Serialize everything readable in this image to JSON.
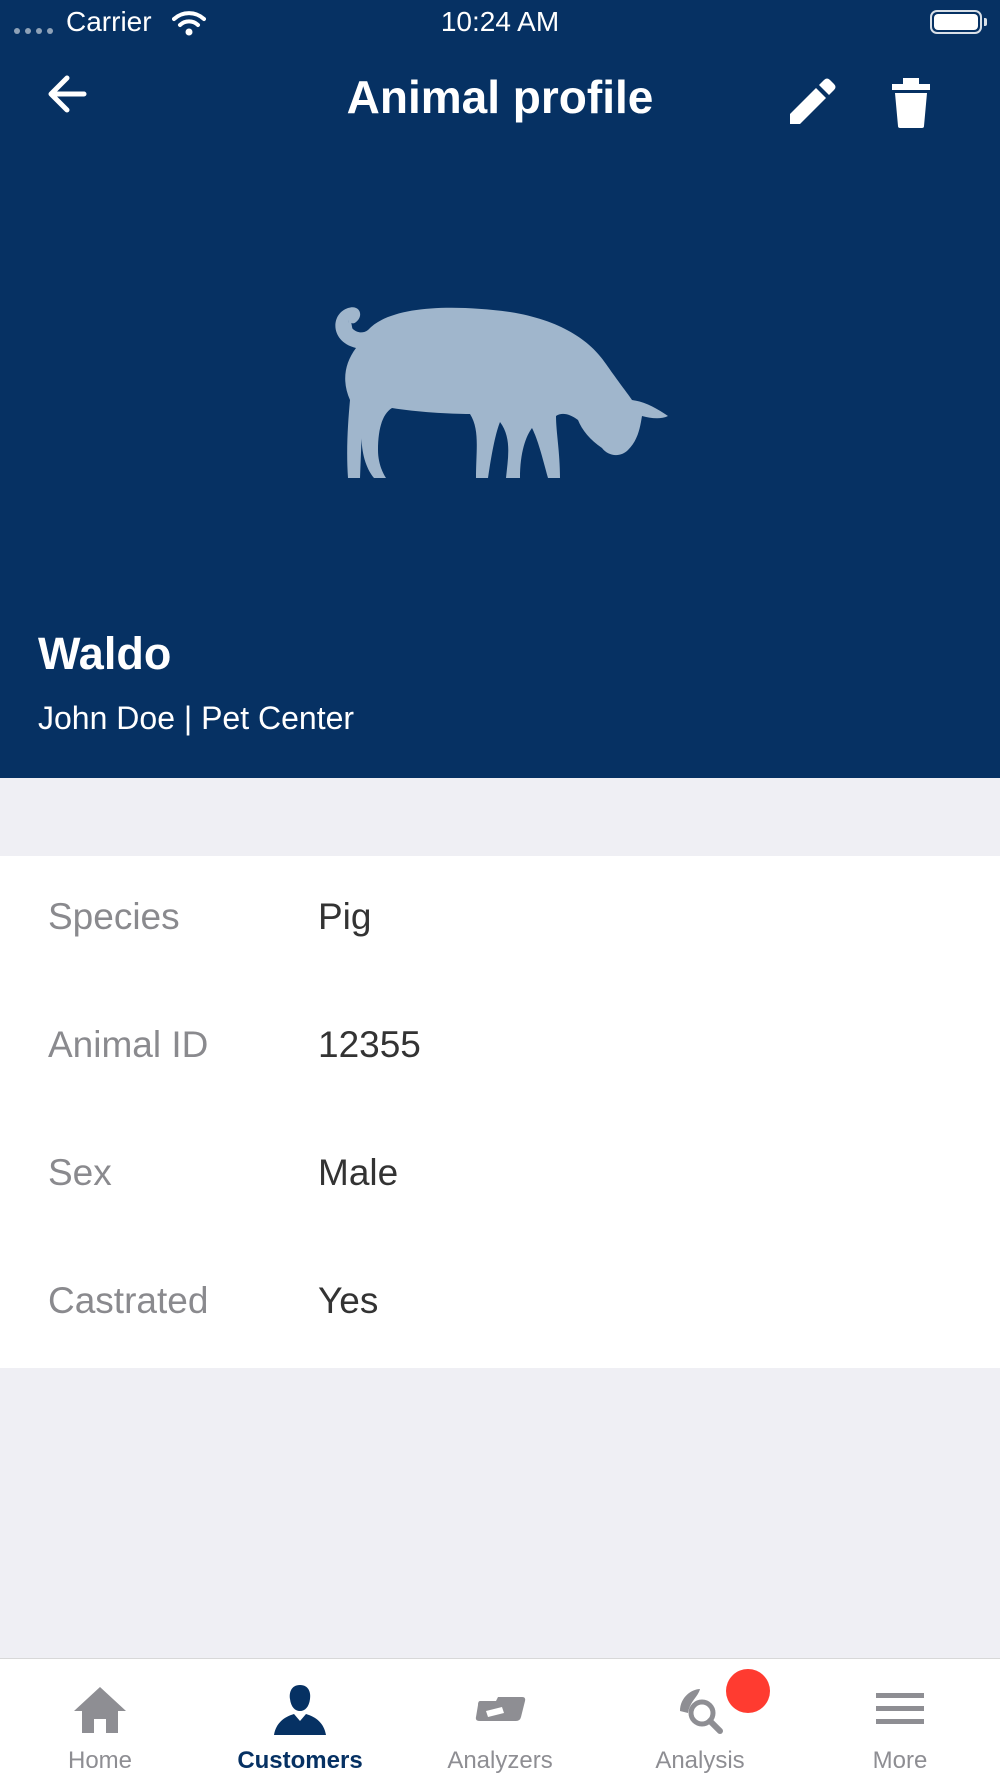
{
  "status_bar": {
    "carrier": "Carrier",
    "time": "10:24 AM"
  },
  "nav": {
    "title": "Animal profile"
  },
  "icons": {
    "back": "arrow-back-icon",
    "edit": "pencil-icon",
    "delete": "trash-icon",
    "animal": "pig-silhouette-icon"
  },
  "animal": {
    "name": "Waldo",
    "owner_line": "John Doe | Pet Center"
  },
  "details": [
    {
      "label": "Species",
      "value": "Pig"
    },
    {
      "label": "Animal ID",
      "value": "12355"
    },
    {
      "label": "Sex",
      "value": "Male"
    },
    {
      "label": "Castrated",
      "value": "Yes"
    }
  ],
  "tabbar": {
    "active": "Customers",
    "tabs": [
      {
        "label": "Home",
        "icon": "home-icon"
      },
      {
        "label": "Customers",
        "icon": "person-icon"
      },
      {
        "label": "Analyzers",
        "icon": "analyzer-icon"
      },
      {
        "label": "Analysis",
        "icon": "analysis-search-icon",
        "badge": true
      },
      {
        "label": "More",
        "icon": "menu-icon"
      }
    ]
  },
  "colors": {
    "header_bg": "#063163",
    "page_bg": "#efeff4",
    "active_tab": "#063163",
    "inactive_tab": "#8e8e93",
    "badge": "#ff3b30",
    "animal_silhouette": "#a0b6cc"
  }
}
